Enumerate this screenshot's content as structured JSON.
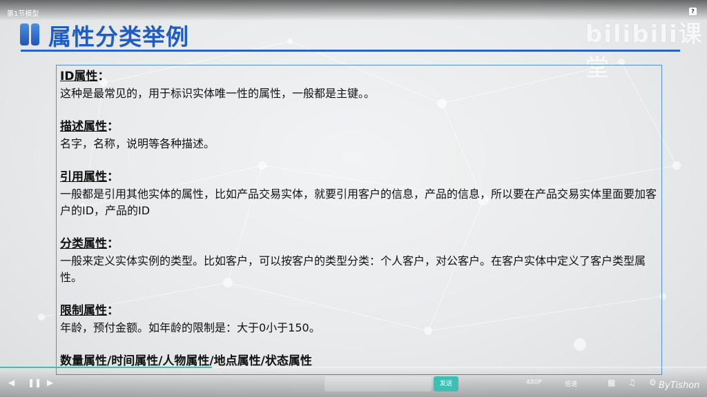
{
  "window": {
    "video_title": "第1节模型",
    "help_label": "?"
  },
  "slide": {
    "title": "属性分类举例",
    "items": [
      {
        "head": "ID属性",
        "suffix": "：",
        "text": "这种是最常见的，用于标识实体唯一性的属性，一般都是主键。。"
      },
      {
        "head": "描述属性",
        "suffix": "：",
        "text": "名字，名称，说明等各种描述。"
      },
      {
        "head": "引用属性",
        "suffix": "：",
        "text": "一般都是引用其他实体的属性，比如产品交易实体，就要引用客户的信息，产品的信息，所以要在产品交易实体里面要加客户的ID，产品的ID"
      },
      {
        "head": "分类属性",
        "suffix": "：",
        "text": "一般来定义实体实例的类型。比如客户，可以按客户的类型分类：个人客户，对公客户。在客户实体中定义了客户类型属性。"
      },
      {
        "head": "限制属性",
        "suffix": "：",
        "text": "年龄，预付金额。如年龄的限制是：大于0小于150。"
      }
    ],
    "summary": "数量属性/时间属性/人物属性/地点属性/状态属性"
  },
  "watermark": {
    "logo": "bilibili课堂",
    "corner": "ByTishon"
  },
  "player": {
    "progress_fraction": 0.3,
    "send_label": "发送",
    "quality_label": "480P",
    "speed_label": "倍速",
    "accent_color": "#3fbfb3"
  }
}
